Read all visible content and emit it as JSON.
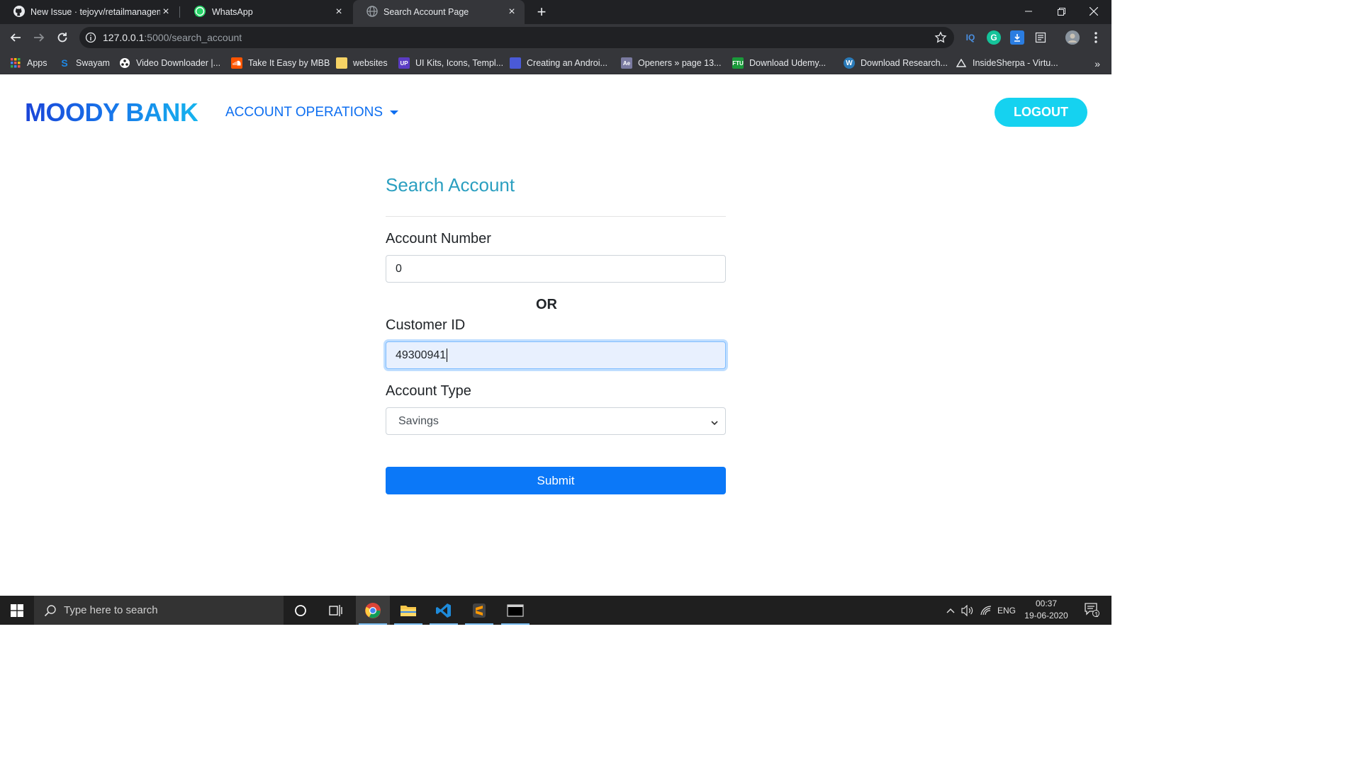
{
  "browser": {
    "tabs": [
      {
        "title": "New Issue · tejoyv/retailmanagem",
        "icon": "github-icon",
        "active": false
      },
      {
        "title": "WhatsApp",
        "icon": "whatsapp-icon",
        "active": false
      },
      {
        "title": "Search Account Page",
        "icon": "globe-icon",
        "active": true
      }
    ],
    "url_host": "127.0.0.1",
    "url_rest": ":5000/search_account",
    "bookmarks": [
      "Apps",
      "Swayam",
      "Video Downloader |...",
      "Take It Easy by MBB",
      "websites",
      "UI Kits, Icons, Templ...",
      "Creating an Androi...",
      "Openers » page 13...",
      "Download Udemy...",
      "Download Research...",
      "InsideSherpa - Virtu..."
    ],
    "bookmark_more": "»",
    "extensions": [
      "IQ",
      "G"
    ]
  },
  "page": {
    "brand": "MOODY BANK",
    "nav_menu": "ACCOUNT OPERATIONS",
    "logout": "LOGOUT",
    "form": {
      "title": "Search Account",
      "account_number_label": "Account Number",
      "account_number_value": "0",
      "or_text": "OR",
      "customer_id_label": "Customer ID",
      "customer_id_value": "49300941",
      "account_type_label": "Account Type",
      "account_type_value": "Savings",
      "submit_label": "Submit"
    }
  },
  "taskbar": {
    "search_placeholder": "Type here to search",
    "language": "ENG",
    "time": "00:37",
    "date": "19-06-2020",
    "notification_count": "1"
  },
  "colors": {
    "brand_start": "#1a44d8",
    "brand_end": "#16b4ee",
    "nav_link": "#0d6ef0",
    "logout_bg": "#15d2f0",
    "title": "#2b9fc0",
    "submit_bg": "#0b78f8"
  }
}
